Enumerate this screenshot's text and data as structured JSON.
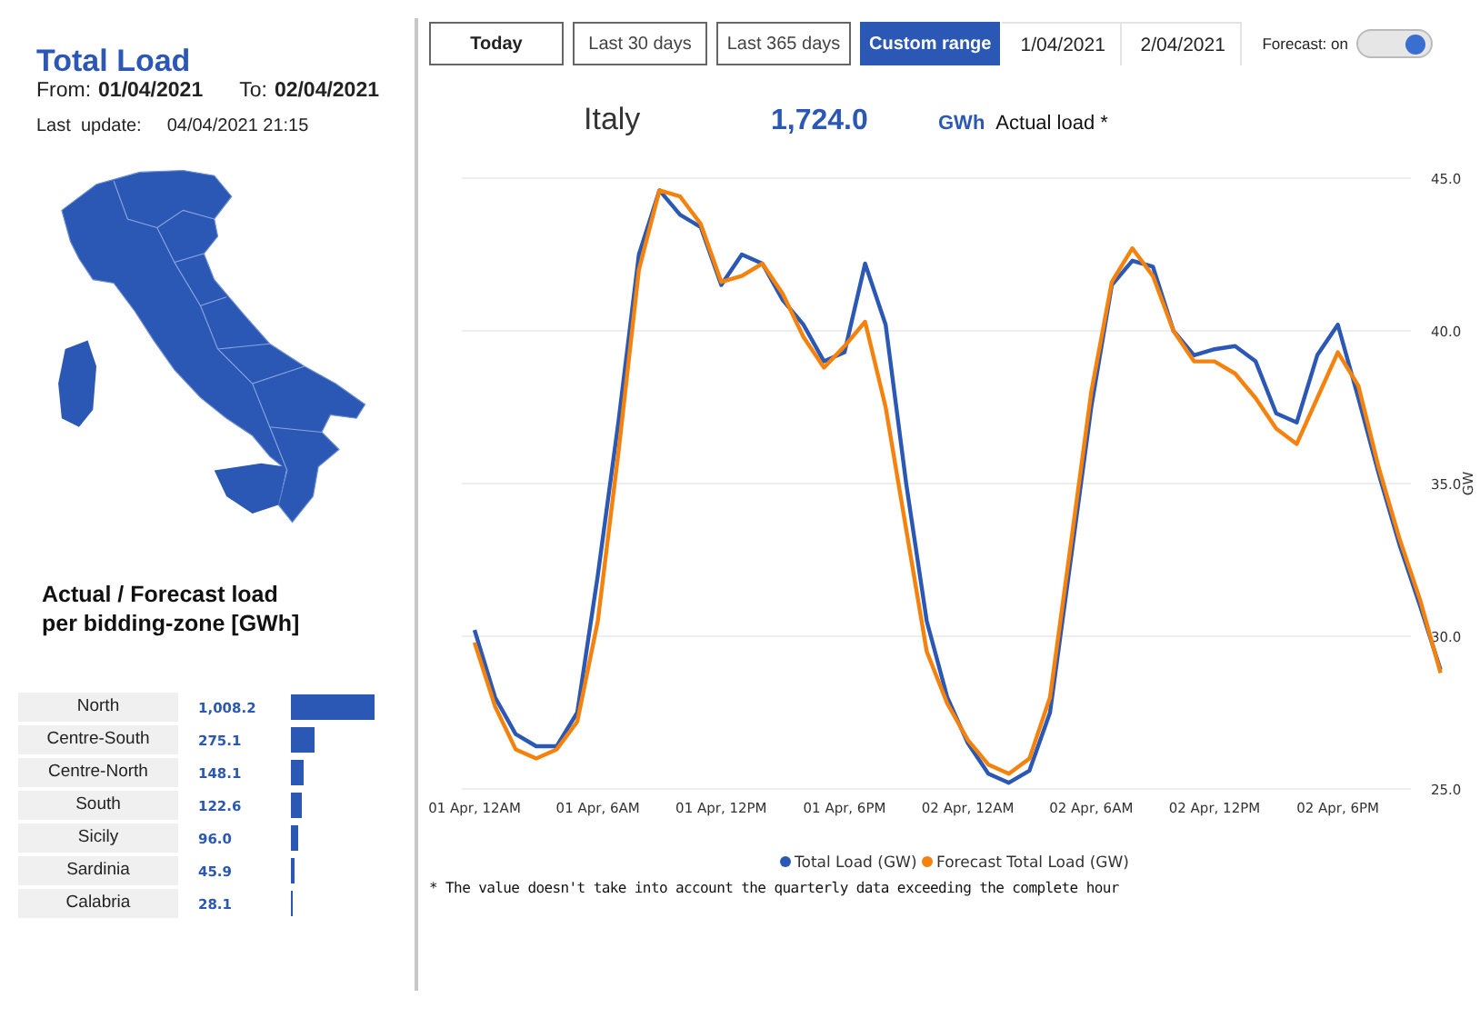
{
  "title": "Total Load",
  "period": {
    "from_label": "From:",
    "from": "01/04/2021",
    "to_label": "To:",
    "to": "02/04/2021"
  },
  "last_update": {
    "label": "Last  update:",
    "value": "04/04/2021 21:15"
  },
  "zones_heading": "Actual / Forecast load per bidding-zone [GWh]",
  "zones": [
    {
      "name": "North",
      "value": "1,008.2"
    },
    {
      "name": "Centre-South",
      "value": "275.1"
    },
    {
      "name": "Centre-North",
      "value": "148.1"
    },
    {
      "name": "South",
      "value": "122.6"
    },
    {
      "name": "Sicily",
      "value": "96.0"
    },
    {
      "name": "Sardinia",
      "value": "45.9"
    },
    {
      "name": "Calabria",
      "value": "28.1"
    }
  ],
  "range_buttons": [
    {
      "label": "Today",
      "selected": false,
      "bold": true
    },
    {
      "label": "Last 30 days",
      "selected": false,
      "bold": false
    },
    {
      "label": "Last 365 days",
      "selected": false,
      "bold": false
    },
    {
      "label": "Custom range",
      "selected": true,
      "bold": true
    }
  ],
  "date_fields": [
    {
      "value": "1/04/2021"
    },
    {
      "value": "2/04/2021"
    }
  ],
  "forecast_toggle": {
    "label": "Forecast: on",
    "on": true
  },
  "headline": {
    "area": "Italy",
    "value": "1,724.0",
    "unit": "GWh",
    "caption": "Actual load *"
  },
  "chart": {
    "chart_data": {
      "type": "line",
      "ylabel": "GW",
      "categories": [
        "01 Apr, 12AM",
        null,
        null,
        null,
        null,
        null,
        "01 Apr, 6AM",
        null,
        null,
        null,
        null,
        null,
        "01 Apr, 12PM",
        null,
        null,
        null,
        null,
        null,
        "01 Apr, 6PM",
        null,
        null,
        null,
        null,
        null,
        "02 Apr, 12AM",
        null,
        null,
        null,
        null,
        null,
        "02 Apr, 6AM",
        null,
        null,
        null,
        null,
        null,
        "02 Apr, 12PM",
        null,
        null,
        null,
        null,
        null,
        "02 Apr, 6PM",
        null,
        null,
        null,
        null,
        null
      ],
      "series": [
        {
          "name": "Total Load (GW)",
          "color": "#2b58b5",
          "values": [
            30.2,
            28,
            26.8,
            26.4,
            26.4,
            27.5,
            32,
            37,
            42.5,
            44.6,
            43.8,
            43.4,
            41.5,
            42.5,
            42.2,
            41,
            40.2,
            39,
            39.3,
            42.2,
            40.2,
            35,
            30.5,
            28,
            26.5,
            25.5,
            25.2,
            25.6,
            27.5,
            32.5,
            37.5,
            41.5,
            42.3,
            42.1,
            40,
            39.2,
            39.4,
            39.5,
            39,
            37.3,
            37,
            39.2,
            40.2,
            37.8,
            35.3,
            33,
            31,
            28.9
          ]
        },
        {
          "name": "Forecast Total Load (GW)",
          "color": "#f5820d",
          "values": [
            29.8,
            27.7,
            26.3,
            26,
            26.3,
            27.2,
            30.5,
            36,
            42,
            44.6,
            44.4,
            43.5,
            41.6,
            41.8,
            42.2,
            41.2,
            39.8,
            38.8,
            39.5,
            40.3,
            37.5,
            33.5,
            29.5,
            27.8,
            26.6,
            25.8,
            25.5,
            26,
            28,
            33,
            38,
            41.6,
            42.7,
            41.8,
            40,
            39,
            39,
            38.6,
            37.8,
            36.8,
            36.3,
            37.8,
            39.3,
            38.2,
            35.5,
            33.2,
            31.2,
            28.8
          ]
        }
      ],
      "ylim": [
        25,
        45
      ],
      "grid": true,
      "legend": "bottom",
      "yticks": [
        {
          "value": 25,
          "label": "25.0"
        },
        {
          "value": 30,
          "label": "30.0"
        },
        {
          "value": 35,
          "label": "35.0"
        },
        {
          "value": 40,
          "label": "40.0"
        },
        {
          "value": 45,
          "label": "45.0"
        }
      ]
    }
  },
  "footnote": "* The value doesn't take into account the quarterly data exceeding the complete hour"
}
